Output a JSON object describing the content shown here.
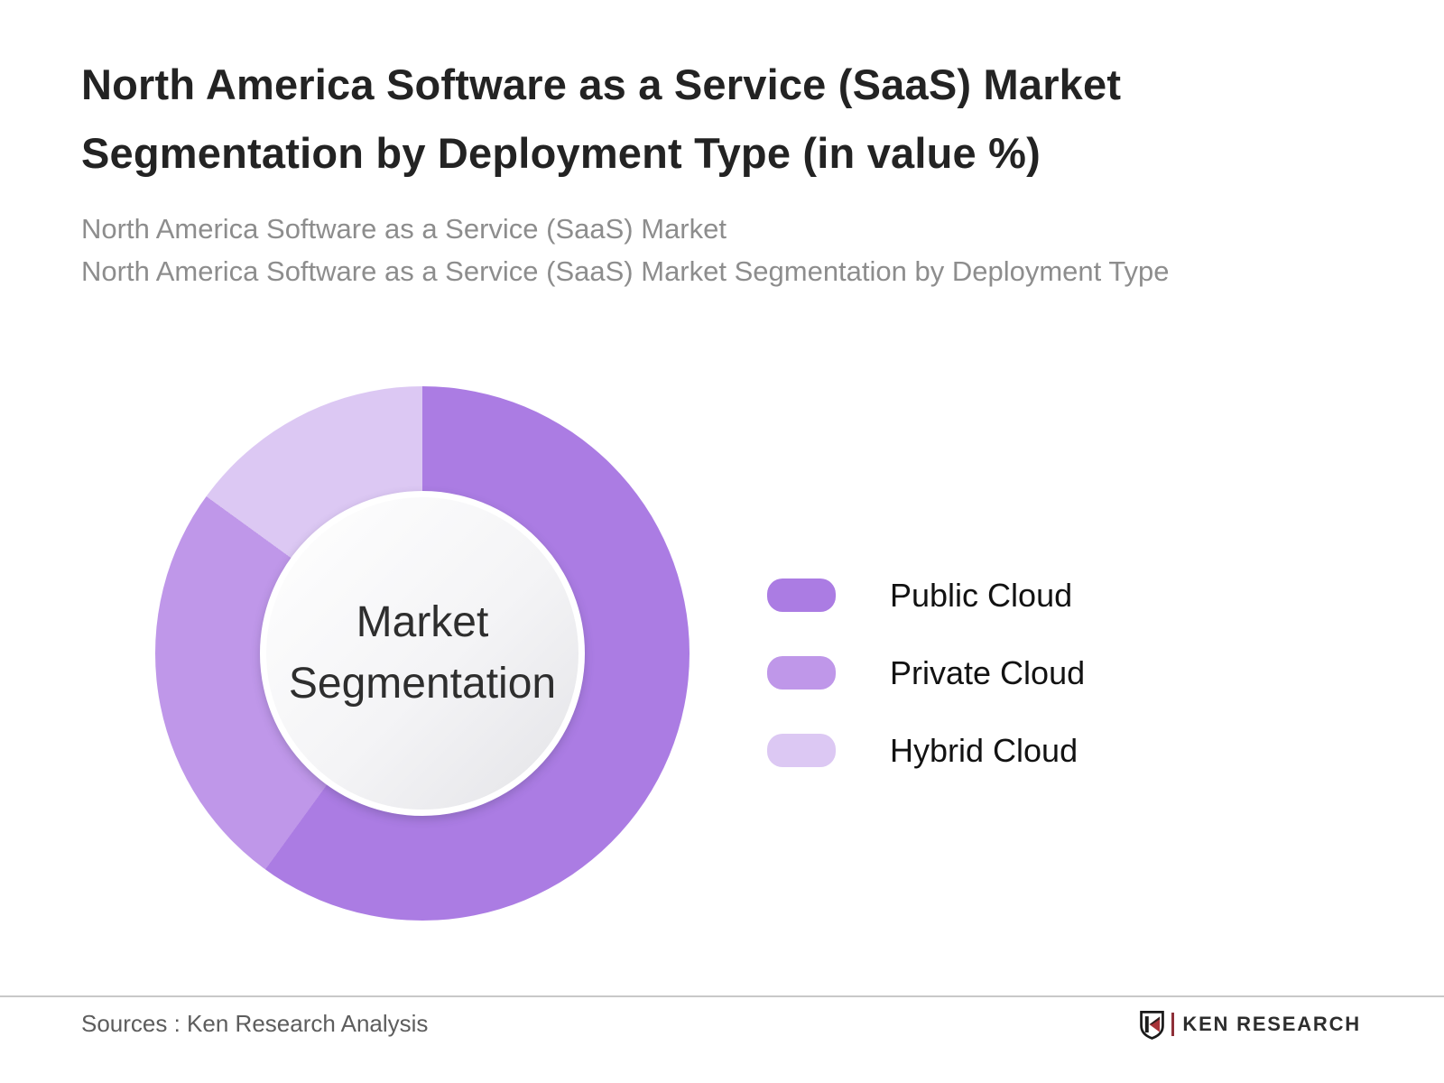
{
  "header": {
    "title_line1": "North America Software as a Service (SaaS) Market",
    "title_line2": "Segmentation by Deployment Type (in value %)",
    "subtitle_line1": "North America Software as a Service (SaaS) Market",
    "subtitle_line2": "North America Software as a Service (SaaS) Market Segmentation by Deployment Type"
  },
  "chart_data": {
    "type": "pie",
    "subtype": "donut",
    "title": "North America Software as a Service (SaaS) Market Segmentation by Deployment Type (in value %)",
    "center_label": "Market Segmentation",
    "unit": "value %",
    "start_angle_deg": 0,
    "direction": "clockwise",
    "legend_position": "right",
    "values_labeled_on_chart": false,
    "segments": [
      {
        "label": "Public Cloud",
        "value_pct": 60,
        "color": "#ab7ce3"
      },
      {
        "label": "Private Cloud",
        "value_pct": 25,
        "color": "#bf97e9"
      },
      {
        "label": "Hybrid Cloud",
        "value_pct": 15,
        "color": "#dcc8f3"
      }
    ],
    "inner_circle_colors": {
      "fill_start": "#ffffff",
      "fill_end": "#e3e3e7",
      "rim": "#ffffff"
    }
  },
  "footer": {
    "sources": "Sources : Ken Research Analysis",
    "logo_text": "KEN RESEARCH",
    "logo_accent_color": "#a83238"
  }
}
